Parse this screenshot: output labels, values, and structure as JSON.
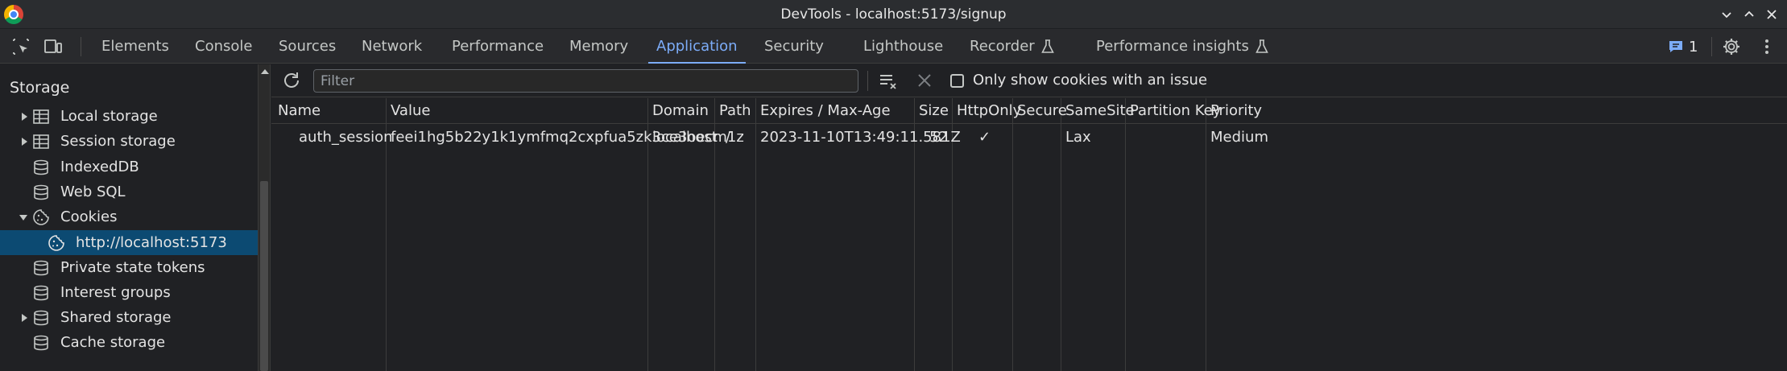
{
  "window": {
    "title": "DevTools - localhost:5173/signup"
  },
  "tabs": [
    {
      "label": "Elements"
    },
    {
      "label": "Console"
    },
    {
      "label": "Sources"
    },
    {
      "label": "Network"
    },
    {
      "label": "Performance"
    },
    {
      "label": "Memory"
    },
    {
      "label": "Application",
      "active": true
    },
    {
      "label": "Security"
    },
    {
      "label": "Lighthouse"
    },
    {
      "label": "Recorder",
      "icon": "flask-icon"
    },
    {
      "label": "Performance insights",
      "icon": "flask-icon"
    }
  ],
  "issues": {
    "count": "1",
    "icon": "message-icon"
  },
  "sidebar": {
    "heading": "Storage",
    "items": [
      {
        "label": "Local storage",
        "icon": "table-icon",
        "expandable": true
      },
      {
        "label": "Session storage",
        "icon": "table-icon",
        "expandable": true
      },
      {
        "label": "IndexedDB",
        "icon": "database-icon"
      },
      {
        "label": "Web SQL",
        "icon": "database-icon"
      },
      {
        "label": "Cookies",
        "icon": "cookie-icon",
        "expanded": true
      },
      {
        "label": "http://localhost:5173",
        "icon": "cookie-icon",
        "selected": true
      },
      {
        "label": "Private state tokens",
        "icon": "database-icon"
      },
      {
        "label": "Interest groups",
        "icon": "database-icon"
      },
      {
        "label": "Shared storage",
        "icon": "database-icon",
        "expandable": true
      },
      {
        "label": "Cache storage",
        "icon": "database-icon"
      }
    ]
  },
  "toolbar": {
    "filter_placeholder": "Filter",
    "only_issues_label": "Only show cookies with an issue",
    "only_issues_checked": false
  },
  "cookies_table": {
    "columns": [
      "Name",
      "Value",
      "Domain",
      "Path",
      "Expires / Max-Age",
      "Size",
      "HttpOnly",
      "Secure",
      "SameSite",
      "Partition Key",
      "Priority"
    ],
    "rows": [
      {
        "name": "auth_session",
        "value": "feei1hg5b22y1k1ymfmq2cxpfua5zk3ce3oecm1z",
        "domain": "localhost",
        "path": "/",
        "expires": "2023-11-10T13:49:11.581Z",
        "size": "52",
        "httponly": "✓",
        "secure": "",
        "samesite": "Lax",
        "partition_key": "",
        "priority": "Medium"
      }
    ]
  },
  "colors": {
    "accent": "#7cacf8",
    "selected_row": "#0c4a72",
    "background": "#202124"
  }
}
